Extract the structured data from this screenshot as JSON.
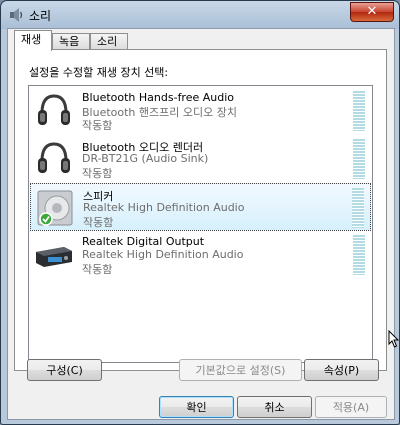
{
  "window": {
    "title": "소리",
    "close_label": "✕"
  },
  "tabs": [
    {
      "label": "재생",
      "active": true
    },
    {
      "label": "녹음",
      "active": false
    },
    {
      "label": "소리",
      "active": false
    }
  ],
  "instruction": "설정을 수정할 재생 장치 선택:",
  "devices": [
    {
      "name": "Bluetooth Hands-free Audio",
      "description": "Bluetooth 핸즈프리 오디오 장치",
      "status": "작동함",
      "icon": "headset-icon",
      "selected": false
    },
    {
      "name": "Bluetooth 오디오 렌더러",
      "description": "DR-BT21G (Audio Sink)",
      "status": "작동함",
      "icon": "headset-icon",
      "selected": false
    },
    {
      "name": "스피커",
      "description": "Realtek High Definition Audio",
      "status": "작동함",
      "icon": "speaker-icon",
      "selected": true
    },
    {
      "name": "Realtek Digital Output",
      "description": "Realtek High Definition Audio",
      "status": "작동함",
      "icon": "digital-output-icon",
      "selected": false
    }
  ],
  "buttons": {
    "configure": "구성(C)",
    "set_default": "기본값으로 설정(S)",
    "properties": "속성(P)",
    "ok": "확인",
    "cancel": "취소",
    "apply": "적용(A)"
  },
  "colors": {
    "meter": "#b2dbe4",
    "selection": "#d6f0fd"
  }
}
